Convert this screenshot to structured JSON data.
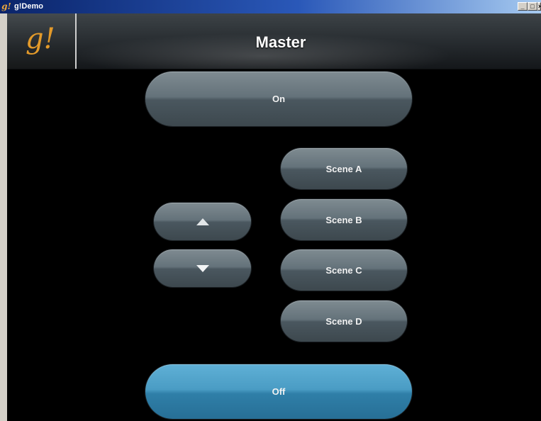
{
  "window": {
    "icon_text": "g!",
    "title": "g!Demo",
    "controls": {
      "minimize": "_",
      "maximize": "□",
      "close": "×"
    }
  },
  "header": {
    "logo_text": "g!",
    "title": "Master"
  },
  "buttons": {
    "on": "On",
    "off": "Off",
    "up_icon": "triangle-up-icon",
    "down_icon": "triangle-down-icon",
    "scenes": [
      "Scene A",
      "Scene B",
      "Scene C",
      "Scene D"
    ]
  },
  "colors": {
    "background": "#000000",
    "pill_gray": "#64727a",
    "pill_blue": "#4a9cc4",
    "logo": "#e39a2a",
    "text": "#f2f2f2"
  }
}
